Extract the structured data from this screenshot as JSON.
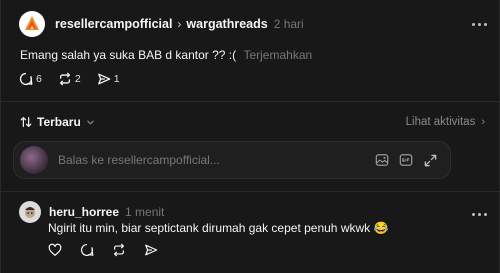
{
  "post": {
    "author": "resellercampofficial",
    "separator": "›",
    "community": "wargathreads",
    "time": "2 hari",
    "text": "Emang salah ya suka BAB d kantor ?? :(",
    "translate_label": "Terjemahkan",
    "stats": {
      "comments": "6",
      "reposts": "2",
      "shares": "1"
    }
  },
  "sort": {
    "label": "Terbaru",
    "activity_label": "Lihat aktivitas",
    "activity_arrow": "›"
  },
  "reply": {
    "placeholder": "Balas ke resellercampofficial..."
  },
  "comment": {
    "author": "heru_horree",
    "time": "1 menit",
    "text": "Ngirit itu min, biar septictank dirumah gak cepet penuh wkwk 😂"
  },
  "colors": {
    "background": "#181818",
    "text": "#f3f5f7",
    "muted": "#777777",
    "brand": "#e8452c"
  }
}
